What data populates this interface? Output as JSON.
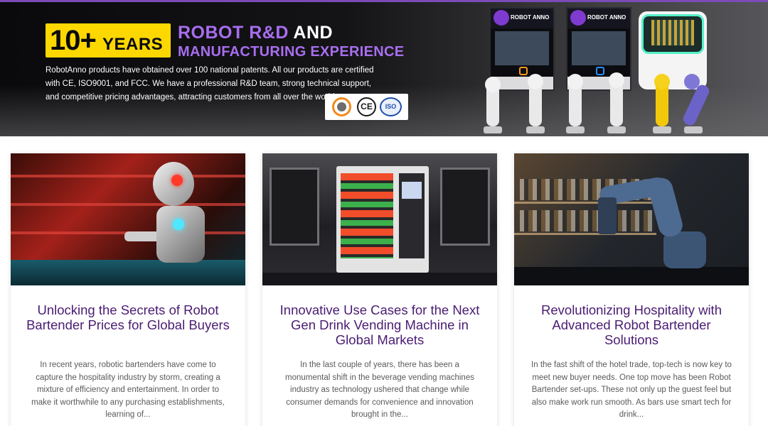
{
  "hero": {
    "years_number": "10+",
    "years_word": "YEARS",
    "headline_purple": "ROBOT R&D",
    "headline_white": "AND",
    "headline_line2": "MANUFACTURING EXPERIENCE",
    "description": "RobotAnno products have obtained over 100 national patents. All our products are certified with CE, ISO9001, and FCC. We have a professional R&D team, strong technical support, and competitive pricing advantages, attracting customers from all over the world.",
    "certifications": [
      "SGS",
      "CE",
      "ISO"
    ],
    "machine_brand_1": "ROBOT ANNO",
    "machine_brand_2": "ROBOT ANNO"
  },
  "cards": [
    {
      "image": "robot-bartender-photo",
      "title": "Unlocking the Secrets of Robot Bartender Prices for Global Buyers",
      "excerpt": "In recent years, robotic bartenders have come to capture the hospitality industry by storm, creating a mixture of efficiency and entertainment. In order to make it worthwhile to any purchasing establishments, learning of..."
    },
    {
      "image": "vending-machine-photo",
      "title": "Innovative Use Cases for the Next Gen Drink Vending Machine in Global Markets",
      "excerpt": "In the last couple of years, there has been a monumental shift in the beverage vending machines industry as technology ushered that change while consumer demands for convenience and innovation brought in the..."
    },
    {
      "image": "robot-arm-photo",
      "title": "Revolutionizing Hospitality with Advanced Robot Bartender Solutions",
      "excerpt": "In the fast shift of the hotel trade, top-tech is now key to meet new buyer needs. One top move has been Robot Bartender set-ups. These not only up the guest feel but also make work run smooth. As bars use smart tech for drink..."
    }
  ],
  "colors": {
    "accent_purple": "#a86ef0",
    "title_purple": "#4a1c73",
    "badge_yellow": "#fcd800"
  }
}
